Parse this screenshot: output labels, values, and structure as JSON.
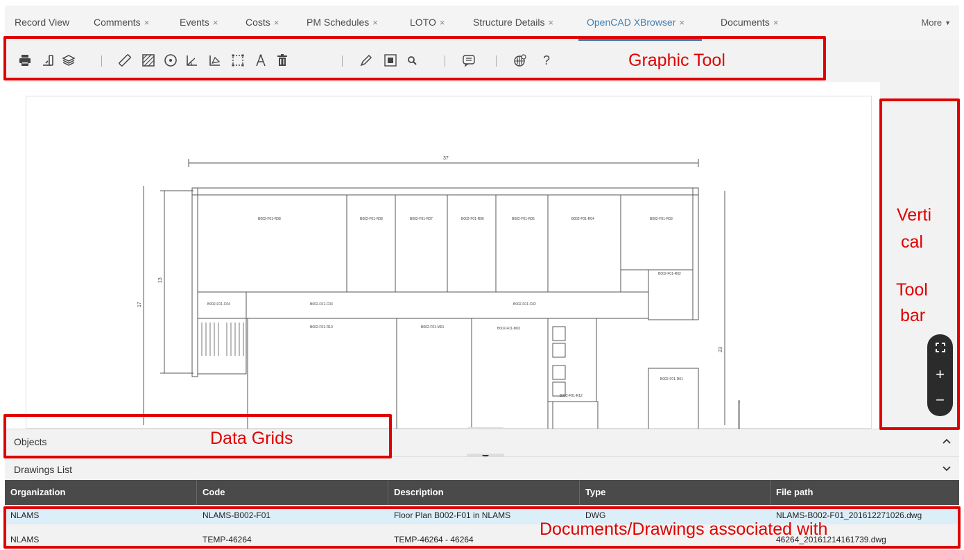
{
  "tabs": [
    {
      "label": "Record View",
      "closable": false
    },
    {
      "label": "Comments",
      "closable": true
    },
    {
      "label": "Events",
      "closable": true
    },
    {
      "label": "Costs",
      "closable": true
    },
    {
      "label": "PM Schedules",
      "closable": true
    },
    {
      "label": "LOTO",
      "closable": true
    },
    {
      "label": "Structure Details",
      "closable": true
    },
    {
      "label": "OpenCAD XBrowser",
      "closable": true,
      "active": true
    },
    {
      "label": "Documents",
      "closable": true
    }
  ],
  "tab_close_glyph": "×",
  "more_label": "More",
  "toolbar_icons": [
    "print-icon",
    "paste-icon",
    "layers-icon",
    "measure-icon",
    "hatch-icon",
    "circle-target-icon",
    "angle-icon",
    "area-icon",
    "select-frame-icon",
    "compass-icon",
    "delete-icon",
    "pencil-icon",
    "zoom-window-icon",
    "search-icon",
    "comment-icon",
    "globe-icon",
    "help-icon"
  ],
  "help_glyph": "?",
  "floorplan": {
    "dim_top": "37",
    "dim_left_outer": "17",
    "dim_left_inner": "13",
    "dim_right": "23",
    "rooms": [
      "B002-F01-R08",
      "B002-F01-R08",
      "B002-F01-R07",
      "B002-F01-R06",
      "B002-F01-R05",
      "B002-F01-R04",
      "B002-F01-R03",
      "B002-F01-R02",
      "B002-F01-C04",
      "B002-F01-C03",
      "B002-F01-C02",
      "B002-F01-R10",
      "B002-F01-M01",
      "B002-F01-M02",
      "B002-F01-R01",
      "B002-F01-R12"
    ]
  },
  "vertical_toolbar": {
    "fullscreen_icon": "fullscreen-icon",
    "zoom_in": "+",
    "zoom_out": "−"
  },
  "panels": {
    "objects_title": "Objects",
    "drawings_title": "Drawings List"
  },
  "table": {
    "columns": [
      "Organization",
      "Code",
      "Description",
      "Type",
      "File path"
    ],
    "rows": [
      [
        "NLAMS",
        "NLAMS-B002-F01",
        "Floor Plan B002-F01 in NLAMS",
        "DWG",
        "NLAMS-B002-F01_201612271026.dwg"
      ],
      [
        "NLAMS",
        "TEMP-46264",
        "TEMP-46264 - 46264",
        "",
        "46264_20161214161739.dwg"
      ]
    ]
  },
  "annotations": {
    "graphic_tool": "Graphic Tool",
    "vertical_line1": "Verti",
    "vertical_line2": "cal",
    "vertical_line3": "Tool",
    "vertical_line4": "bar",
    "data_grids": "Data Grids",
    "documents": "Documents/Drawings associated with"
  },
  "colors": {
    "accent": "#3d7fb5",
    "annotation": "#e00000",
    "header_dark": "#4a4a4a",
    "selected_row": "#dceef8"
  }
}
